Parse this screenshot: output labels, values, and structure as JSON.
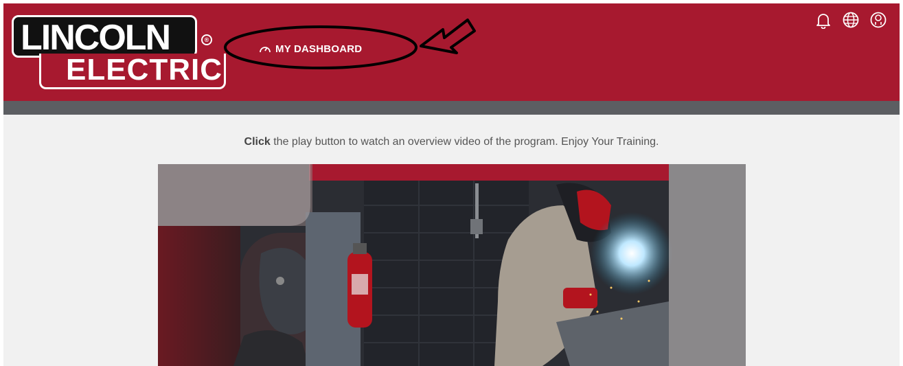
{
  "brand": {
    "line1": "LINCOLN",
    "line2": "ELECTRIC",
    "registered": "®"
  },
  "nav": {
    "dashboard_label": "MY DASHBOARD",
    "dashboard_icon": "gauge-icon"
  },
  "header_icons": [
    "bell-icon",
    "globe-icon",
    "user-icon"
  ],
  "instruction": {
    "emphasis": "Click",
    "text": " the play button to watch an overview video of the program.  Enjoy Your Training."
  },
  "colors": {
    "brand_red": "#a7192f",
    "subbar_gray": "#5c5e62",
    "page_bg": "#f1f1f1"
  }
}
